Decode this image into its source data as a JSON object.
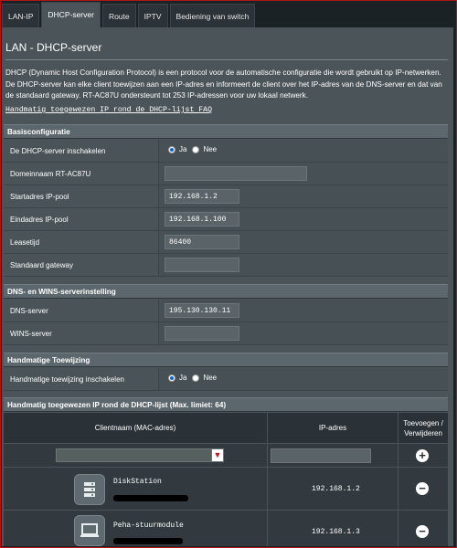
{
  "tabs": [
    "LAN-IP",
    "DHCP-server",
    "Route",
    "IPTV",
    "Bediening van switch"
  ],
  "active_tab": 1,
  "page_title": "LAN - DHCP-server",
  "description": "DHCP (Dynamic Host Configuration Protocol) is een protocol voor de automatische configuratie die wordt gebruikt op IP-netwerken. De DHCP-server kan elke client toewijzen aan een IP-adres en informeert de client over het IP-adres van de DNS-server en dat van de standaard gateway. RT-AC87U ondersteunt tot 253 IP-adressen voor uw lokaal netwerk.",
  "faq_link": "Handmatig toegewezen IP rond de DHCP-lijst FAQ",
  "basic": {
    "heading": "Basisconfiguratie",
    "enable_label": "De DHCP-server inschakelen",
    "radio_yes": "Ja",
    "radio_no": "Nee",
    "enable_value": "Ja",
    "domain_label": "Domeinnaam RT-AC87U",
    "domain_value": "",
    "start_label": "Startadres IP-pool",
    "start_value": "192.168.1.2",
    "end_label": "Eindadres IP-pool",
    "end_value": "192.168.1.100",
    "lease_label": "Leasetijd",
    "lease_value": "86400",
    "gateway_label": "Standaard gateway",
    "gateway_value": ""
  },
  "dns": {
    "heading": "DNS- en WINS-serverinstelling",
    "dns_label": "DNS-server",
    "dns_value": "195.130.130.11",
    "wins_label": "WINS-server",
    "wins_value": ""
  },
  "manual": {
    "heading": "Handmatige Toewijzing",
    "enable_label": "Handmatige toewijzing inschakelen",
    "enable_value": "Ja"
  },
  "list": {
    "heading": "Handmatig toegewezen IP rond de DHCP-lijst (Max. limiet: 64)",
    "col_client": "Clientnaam (MAC-adres)",
    "col_ip": "IP-adres",
    "col_action": "Toevoegen / Verwijderen",
    "add_placeholder": "",
    "entries": [
      {
        "name": "DiskStation",
        "ip": "192.168.1.2",
        "icon": "server-icon"
      },
      {
        "name": "Peha-stuurmodule",
        "ip": "192.168.1.3",
        "icon": "laptop-icon"
      }
    ]
  }
}
